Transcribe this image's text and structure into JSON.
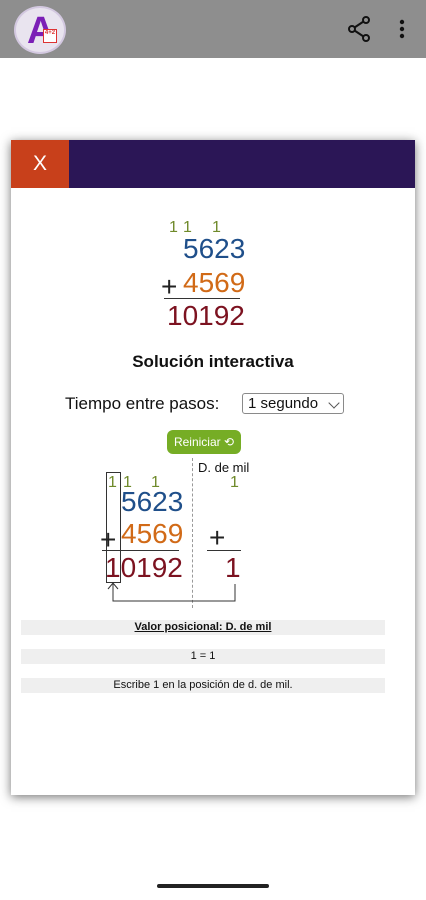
{
  "app": {
    "logo_letter": "A",
    "logo_mini": "4+2"
  },
  "top_example": {
    "carries": [
      "1",
      "1",
      "1"
    ],
    "addend1": "5623",
    "operator": "+",
    "addend2": "4569",
    "result": "10192"
  },
  "section_title": "Solución interactiva",
  "controls": {
    "time_label": "Tiempo entre pasos:",
    "time_value": "1 segundo",
    "reset_label": "Reiniciar ⟲"
  },
  "interactive": {
    "carries": [
      "1",
      "1",
      "1"
    ],
    "addend1": "5623",
    "operator": "+",
    "addend2": "4569",
    "result": "10192",
    "column_label": "D. de mil",
    "column_carry": "1",
    "column_operator": "+",
    "column_result": "1"
  },
  "info": {
    "heading": "Valor posicional: D. de mil",
    "equation": "1 = 1",
    "instruction": "Escribe 1 en la posición de d. de mil."
  },
  "dialog": {
    "close_label": "X"
  }
}
